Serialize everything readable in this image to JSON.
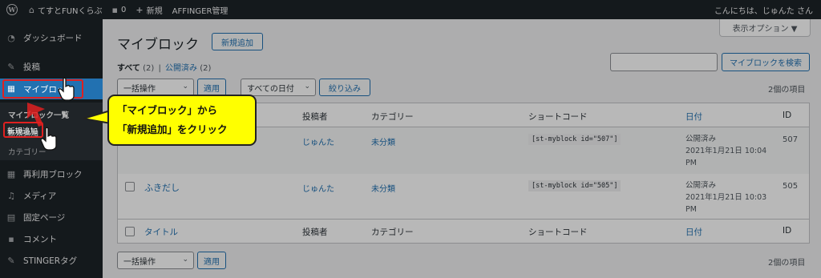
{
  "adminbar": {
    "site_name": "てすとFUNくらぶ",
    "comments_count": "0",
    "new_label": "新規",
    "affinger_label": "AFFINGER管理",
    "greeting": "こんにちは、じゅんた さん"
  },
  "sidebar": {
    "items": [
      {
        "label": "ダッシュボード",
        "icon": "dashboard-icon"
      },
      {
        "label": "投稿",
        "icon": "pin-icon"
      },
      {
        "label": "マイブロック",
        "icon": "blocks-icon"
      },
      {
        "label": "再利用ブロック",
        "icon": "blocks-icon"
      },
      {
        "label": "メディア",
        "icon": "media-icon"
      },
      {
        "label": "固定ページ",
        "icon": "page-icon"
      },
      {
        "label": "コメント",
        "icon": "comment-icon"
      },
      {
        "label": "STINGERタグ",
        "icon": "pin-icon"
      }
    ],
    "submenu": [
      "マイブロック一覧",
      "新規追加",
      "カテゴリー"
    ]
  },
  "main": {
    "title": "マイブロック",
    "add_new": "新規追加",
    "screen_options": "表示オプション ▼",
    "filter_all": "すべて",
    "filter_all_count": "(2)",
    "filter_separator": "|",
    "filter_published": "公開済み",
    "filter_published_count": "(2)",
    "search_button": "マイブロックを検索",
    "bulk_action": "一括操作",
    "apply": "適用",
    "all_dates": "すべての日付",
    "filter_button": "絞り込み",
    "item_count": "2個の項目"
  },
  "table": {
    "columns": {
      "title": "タイトル",
      "author": "投稿者",
      "category": "カテゴリー",
      "shortcode": "ショートコード",
      "date": "日付",
      "id": "ID"
    },
    "rows": [
      {
        "title": "",
        "author": "じゅんた",
        "category": "未分類",
        "shortcode": "[st-myblock id=\"507\"]",
        "status": "公開済み",
        "date": "2021年1月21日 10:04",
        "ampm": "PM",
        "id": "507"
      },
      {
        "title": "ふきだし",
        "author": "じゅんた",
        "category": "未分類",
        "shortcode": "[st-myblock id=\"505\"]",
        "status": "公開済み",
        "date": "2021年1月21日 10:03",
        "ampm": "PM",
        "id": "505"
      }
    ]
  },
  "callout": {
    "line1": "「マイブロック」から",
    "line2": "「新規追加」をクリック"
  },
  "colors": {
    "accent": "#2271b1",
    "callout_bg": "#ffff00",
    "highlight": "#e02020"
  }
}
